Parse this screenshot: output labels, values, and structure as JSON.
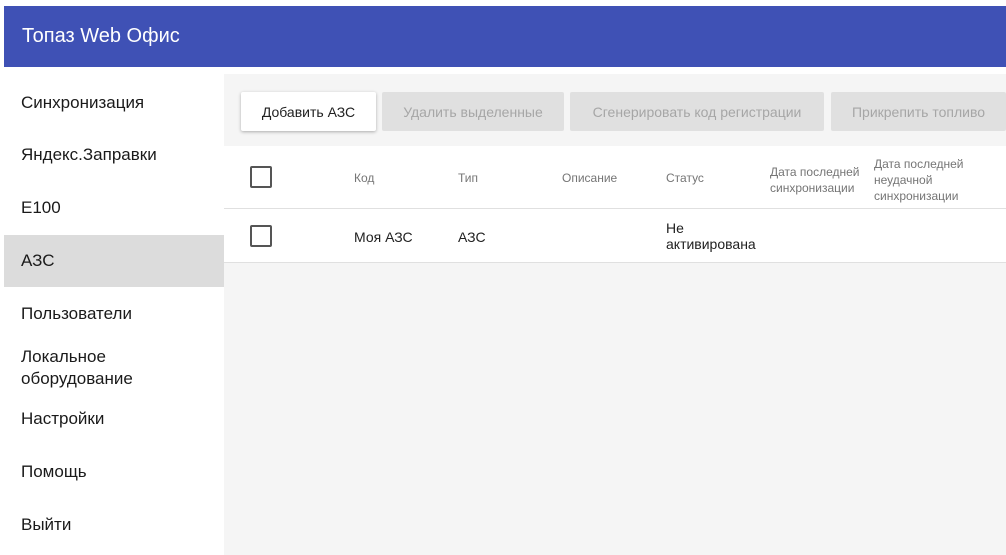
{
  "app": {
    "title": "Топаз Web Офис"
  },
  "sidebar": {
    "items": [
      {
        "label": "Синхронизация"
      },
      {
        "label": "Яндекс.Заправки"
      },
      {
        "label": "Е100"
      },
      {
        "label": "АЗС",
        "active": true
      },
      {
        "label": "Пользователи"
      },
      {
        "label": "Локальное оборудование"
      },
      {
        "label": "Настройки"
      },
      {
        "label": "Помощь"
      },
      {
        "label": "Выйти"
      }
    ]
  },
  "toolbar": {
    "add_label": "Добавить АЗС",
    "delete_label": "Удалить выделенные",
    "generate_label": "Сгенерировать код регистрации",
    "attach_label": "Прикрепить топливо"
  },
  "table": {
    "columns": [
      "Код",
      "Тип",
      "Описание",
      "Статус",
      "Дата последней синхронизации",
      "Дата последней неудачной синхронизации"
    ],
    "rows": [
      {
        "code": "Моя АЗС",
        "type": "АЗС",
        "description": "",
        "status": "Не активирована",
        "last_sync": "",
        "last_failed_sync": ""
      }
    ]
  },
  "colors": {
    "appbar": "#3f51b5",
    "active_item": "#dcdcdc",
    "content_bg": "#f5f5f5"
  }
}
